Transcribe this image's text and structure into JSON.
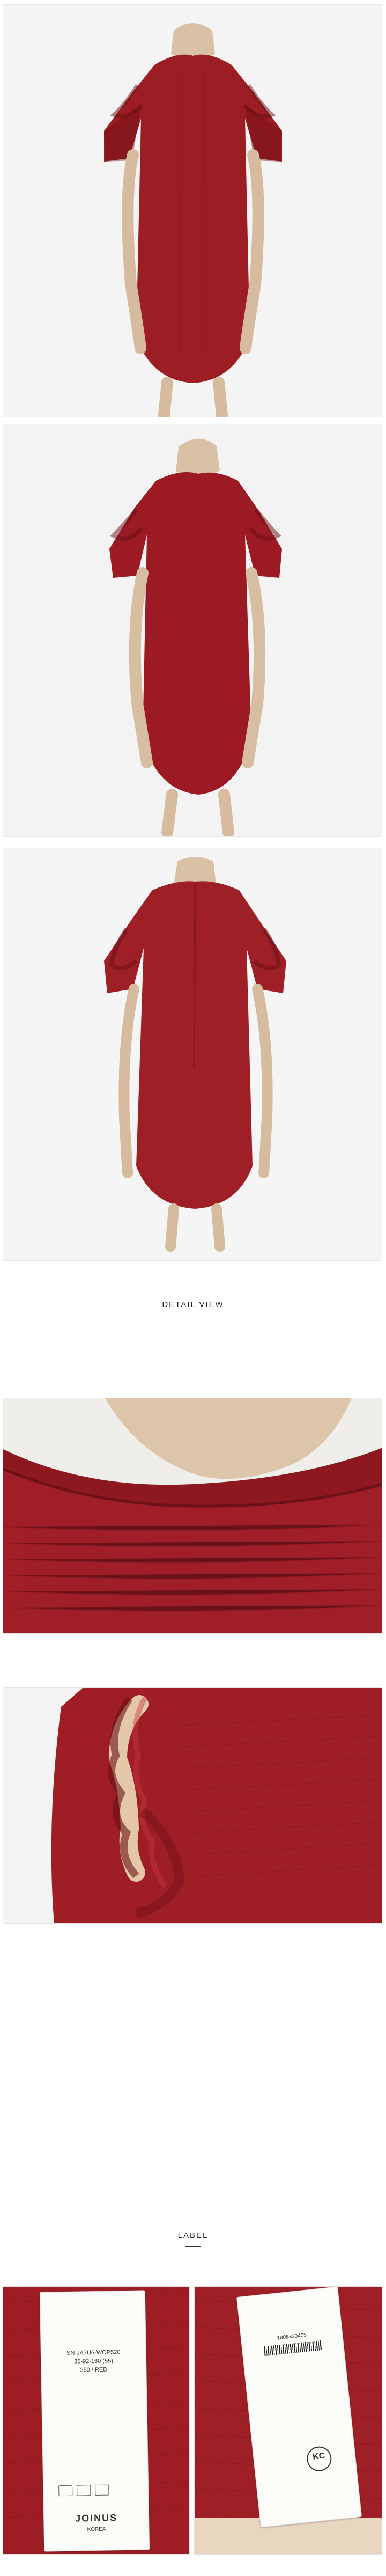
{
  "sections": {
    "detail_view": "DETAIL VIEW",
    "label": "LABEL"
  },
  "label_tags": {
    "left": {
      "line1": "SN-JA7U6-WOP520",
      "line2": "85-92-160 (55)",
      "line3": "250 / RED",
      "brand": "JOINUS",
      "origin": "KOREA"
    },
    "right": {
      "barcode": "1808320405",
      "code": "KC"
    }
  },
  "colors": {
    "dress_red": "#9d1d24",
    "dress_shadow": "#5c0c12",
    "mannequin": "#d8c1a5"
  }
}
